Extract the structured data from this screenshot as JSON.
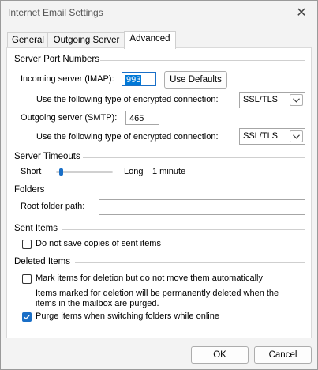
{
  "window": {
    "title": "Internet Email Settings"
  },
  "tabs": [
    {
      "label": "General"
    },
    {
      "label": "Outgoing Server"
    },
    {
      "label": "Advanced"
    }
  ],
  "server_ports": {
    "section_title": "Server Port Numbers",
    "incoming_label": "Incoming server (IMAP):",
    "incoming_value": "993",
    "use_defaults_label": "Use Defaults",
    "incoming_encryption_label": "Use the following type of encrypted connection:",
    "incoming_encryption_value": "SSL/TLS",
    "outgoing_label": "Outgoing server (SMTP):",
    "outgoing_value": "465",
    "outgoing_encryption_label": "Use the following type of encrypted connection:",
    "outgoing_encryption_value": "SSL/TLS"
  },
  "server_timeouts": {
    "section_title": "Server Timeouts",
    "short_label": "Short",
    "long_label": "Long",
    "value_label": "1 minute",
    "slider_fraction": 0.05
  },
  "folders": {
    "section_title": "Folders",
    "root_label": "Root folder path:",
    "root_value": ""
  },
  "sent_items": {
    "section_title": "Sent Items",
    "no_copies_label": "Do not save copies of sent items",
    "no_copies_checked": false
  },
  "deleted_items": {
    "section_title": "Deleted Items",
    "mark_label": "Mark items for deletion but do not move them automatically",
    "mark_checked": false,
    "note_line1": "Items marked for deletion will be permanently deleted when the",
    "note_line2": "items in the mailbox are purged.",
    "purge_label": "Purge items when switching folders while online",
    "purge_checked": true
  },
  "footer": {
    "ok_label": "OK",
    "cancel_label": "Cancel"
  },
  "colors": {
    "accent": "#1a6fc7",
    "selection": "#0078d7"
  }
}
